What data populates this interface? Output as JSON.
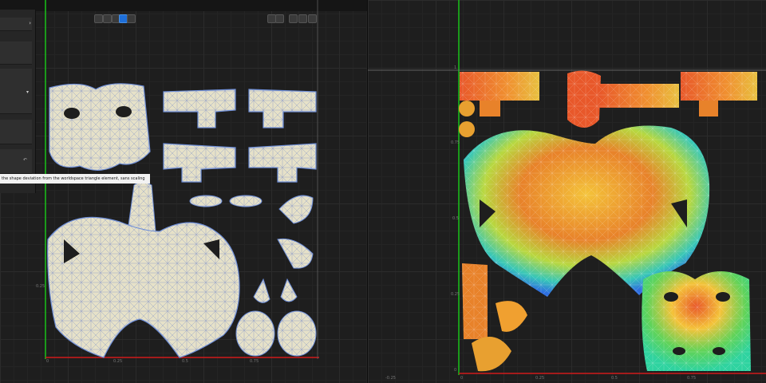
{
  "left_view": {
    "tooltip": "the shape deviation from the worldspace triangle element, sans scaling",
    "x_ticks": [
      "0",
      "0.25",
      "0.5",
      "0.75"
    ],
    "y_ticks": [
      "0.25"
    ],
    "toolbar_icons": [
      "grid-icon",
      "lock-icon",
      "settings-icon",
      "expand-icon",
      "camera-icon"
    ],
    "view_buttons": [
      "move-tool-icon",
      "rotate-tool-icon",
      "scale-tool-icon",
      "select-tool-icon",
      "display-mode-icon"
    ]
  },
  "right_view": {
    "x_ticks": [
      "-0.25",
      "0",
      "0.25",
      "0.5",
      "0.75"
    ],
    "y_ticks": [
      "1",
      "0.75",
      "0.5",
      "0.25",
      "0"
    ]
  },
  "colors": {
    "background": "#1e1e1e",
    "u_axis": "#d11a1a",
    "v_axis": "#18c418",
    "island_fill": "#e8e2c6",
    "island_edge": "#6f8fd8",
    "heat_hot": "#e8582a",
    "heat_mid": "#f4c33a",
    "heat_cool": "#5fd35a",
    "heat_cold": "#2f6fe0"
  }
}
